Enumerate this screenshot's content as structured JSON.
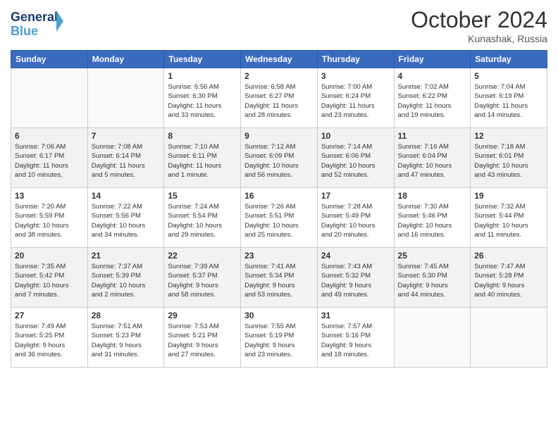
{
  "header": {
    "logo_line1": "General",
    "logo_line2": "Blue",
    "month": "October 2024",
    "location": "Kunashak, Russia"
  },
  "weekdays": [
    "Sunday",
    "Monday",
    "Tuesday",
    "Wednesday",
    "Thursday",
    "Friday",
    "Saturday"
  ],
  "weeks": [
    [
      {
        "day": "",
        "info": ""
      },
      {
        "day": "",
        "info": ""
      },
      {
        "day": "1",
        "info": "Sunrise: 6:56 AM\nSunset: 6:30 PM\nDaylight: 11 hours\nand 33 minutes."
      },
      {
        "day": "2",
        "info": "Sunrise: 6:58 AM\nSunset: 6:27 PM\nDaylight: 11 hours\nand 28 minutes."
      },
      {
        "day": "3",
        "info": "Sunrise: 7:00 AM\nSunset: 6:24 PM\nDaylight: 11 hours\nand 23 minutes."
      },
      {
        "day": "4",
        "info": "Sunrise: 7:02 AM\nSunset: 6:22 PM\nDaylight: 11 hours\nand 19 minutes."
      },
      {
        "day": "5",
        "info": "Sunrise: 7:04 AM\nSunset: 6:19 PM\nDaylight: 11 hours\nand 14 minutes."
      }
    ],
    [
      {
        "day": "6",
        "info": "Sunrise: 7:06 AM\nSunset: 6:17 PM\nDaylight: 11 hours\nand 10 minutes."
      },
      {
        "day": "7",
        "info": "Sunrise: 7:08 AM\nSunset: 6:14 PM\nDaylight: 11 hours\nand 5 minutes."
      },
      {
        "day": "8",
        "info": "Sunrise: 7:10 AM\nSunset: 6:11 PM\nDaylight: 11 hours\nand 1 minute."
      },
      {
        "day": "9",
        "info": "Sunrise: 7:12 AM\nSunset: 6:09 PM\nDaylight: 10 hours\nand 56 minutes."
      },
      {
        "day": "10",
        "info": "Sunrise: 7:14 AM\nSunset: 6:06 PM\nDaylight: 10 hours\nand 52 minutes."
      },
      {
        "day": "11",
        "info": "Sunrise: 7:16 AM\nSunset: 6:04 PM\nDaylight: 10 hours\nand 47 minutes."
      },
      {
        "day": "12",
        "info": "Sunrise: 7:18 AM\nSunset: 6:01 PM\nDaylight: 10 hours\nand 43 minutes."
      }
    ],
    [
      {
        "day": "13",
        "info": "Sunrise: 7:20 AM\nSunset: 5:59 PM\nDaylight: 10 hours\nand 38 minutes."
      },
      {
        "day": "14",
        "info": "Sunrise: 7:22 AM\nSunset: 5:56 PM\nDaylight: 10 hours\nand 34 minutes."
      },
      {
        "day": "15",
        "info": "Sunrise: 7:24 AM\nSunset: 5:54 PM\nDaylight: 10 hours\nand 29 minutes."
      },
      {
        "day": "16",
        "info": "Sunrise: 7:26 AM\nSunset: 5:51 PM\nDaylight: 10 hours\nand 25 minutes."
      },
      {
        "day": "17",
        "info": "Sunrise: 7:28 AM\nSunset: 5:49 PM\nDaylight: 10 hours\nand 20 minutes."
      },
      {
        "day": "18",
        "info": "Sunrise: 7:30 AM\nSunset: 5:46 PM\nDaylight: 10 hours\nand 16 minutes."
      },
      {
        "day": "19",
        "info": "Sunrise: 7:32 AM\nSunset: 5:44 PM\nDaylight: 10 hours\nand 11 minutes."
      }
    ],
    [
      {
        "day": "20",
        "info": "Sunrise: 7:35 AM\nSunset: 5:42 PM\nDaylight: 10 hours\nand 7 minutes."
      },
      {
        "day": "21",
        "info": "Sunrise: 7:37 AM\nSunset: 5:39 PM\nDaylight: 10 hours\nand 2 minutes."
      },
      {
        "day": "22",
        "info": "Sunrise: 7:39 AM\nSunset: 5:37 PM\nDaylight: 9 hours\nand 58 minutes."
      },
      {
        "day": "23",
        "info": "Sunrise: 7:41 AM\nSunset: 5:34 PM\nDaylight: 9 hours\nand 53 minutes."
      },
      {
        "day": "24",
        "info": "Sunrise: 7:43 AM\nSunset: 5:32 PM\nDaylight: 9 hours\nand 49 minutes."
      },
      {
        "day": "25",
        "info": "Sunrise: 7:45 AM\nSunset: 5:30 PM\nDaylight: 9 hours\nand 44 minutes."
      },
      {
        "day": "26",
        "info": "Sunrise: 7:47 AM\nSunset: 5:28 PM\nDaylight: 9 hours\nand 40 minutes."
      }
    ],
    [
      {
        "day": "27",
        "info": "Sunrise: 7:49 AM\nSunset: 5:25 PM\nDaylight: 9 hours\nand 36 minutes."
      },
      {
        "day": "28",
        "info": "Sunrise: 7:51 AM\nSunset: 5:23 PM\nDaylight: 9 hours\nand 31 minutes."
      },
      {
        "day": "29",
        "info": "Sunrise: 7:53 AM\nSunset: 5:21 PM\nDaylight: 9 hours\nand 27 minutes."
      },
      {
        "day": "30",
        "info": "Sunrise: 7:55 AM\nSunset: 5:19 PM\nDaylight: 9 hours\nand 23 minutes."
      },
      {
        "day": "31",
        "info": "Sunrise: 7:57 AM\nSunset: 5:16 PM\nDaylight: 9 hours\nand 18 minutes."
      },
      {
        "day": "",
        "info": ""
      },
      {
        "day": "",
        "info": ""
      }
    ]
  ]
}
